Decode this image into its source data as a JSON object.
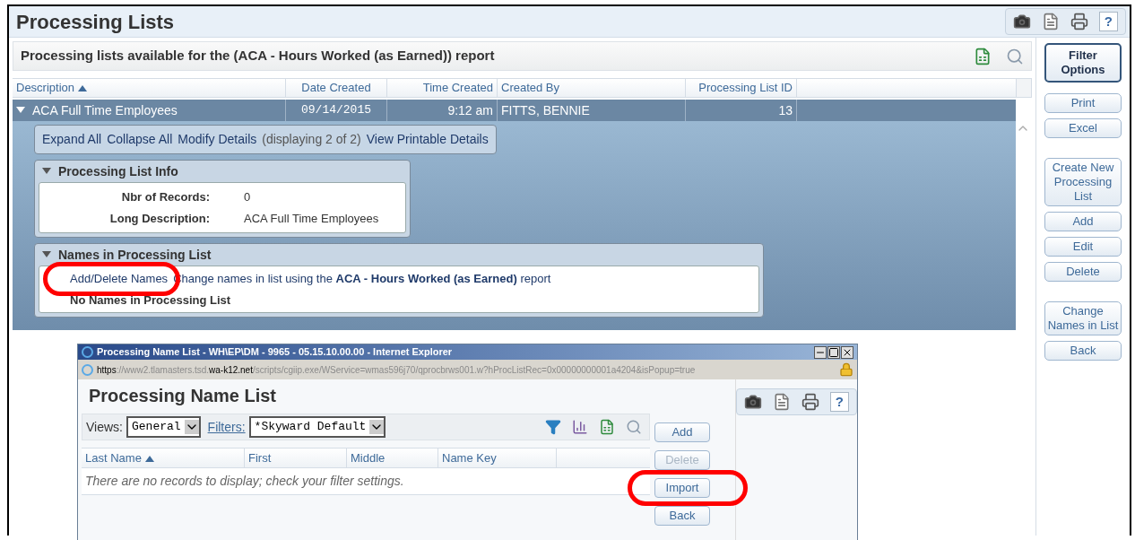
{
  "page": {
    "title": "Processing Lists",
    "help_glyph": "?",
    "subtitle": "Processing lists available for the (ACA - Hours Worked (as Earned)) report"
  },
  "table": {
    "columns": [
      {
        "label": "Description",
        "sorted": true
      },
      {
        "label": "Date Created",
        "sorted": false
      },
      {
        "label": "Time Created",
        "sorted": false
      },
      {
        "label": "Created By",
        "sorted": false
      },
      {
        "label": "Processing List ID",
        "sorted": false
      }
    ],
    "rows": [
      {
        "selected": true,
        "expanded": true,
        "cells": [
          "ACA Full Time Employees",
          "09/14/2015",
          "9:12 am",
          "FITTS, BENNIE",
          "13"
        ]
      }
    ]
  },
  "detail": {
    "links": [
      {
        "kind": "link",
        "text": "Expand All"
      },
      {
        "kind": "link",
        "text": "Collapse All"
      },
      {
        "kind": "link",
        "text": "Modify Details"
      },
      {
        "kind": "note",
        "text": "(displaying 2 of 2)"
      },
      {
        "kind": "link",
        "text": "View Printable Details"
      }
    ],
    "sections": [
      {
        "kind": "fields",
        "title": "Processing List Info",
        "expanded": true,
        "fields": [
          {
            "label": "Nbr of Records:",
            "value": "0"
          },
          {
            "label": "Long Description:",
            "value": "ACA Full Time Employees"
          }
        ]
      },
      {
        "kind": "names",
        "title": "Names in Processing List",
        "expanded": true,
        "link": {
          "text": "Add/Delete Names",
          "highlighted": true
        },
        "note": "Change names in list using the **ACA - Hours Worked (as Earned)** report",
        "empty": "No Names in Processing List"
      }
    ]
  },
  "sidebar": {
    "groups": [
      [
        {
          "kind": "primary",
          "label": "Filter Options"
        }
      ],
      [
        {
          "kind": "normal",
          "label": "Print"
        },
        {
          "kind": "normal",
          "label": "Excel"
        }
      ],
      [
        {
          "kind": "normal",
          "label": "Create New Processing List"
        },
        {
          "kind": "normal",
          "label": "Add"
        },
        {
          "kind": "normal",
          "label": "Edit"
        },
        {
          "kind": "normal",
          "label": "Delete"
        }
      ],
      [
        {
          "kind": "normal",
          "label": "Change Names in List"
        },
        {
          "kind": "normal",
          "label": "Back"
        }
      ]
    ]
  },
  "popup": {
    "window_title": "Processing Name List - WH\\EP\\DM - 9965 - 05.15.10.00.00 - Internet Explorer",
    "url": [
      {
        "text": "https",
        "strong": true
      },
      {
        "text": "://www2.tlamasters.tsd.",
        "strong": false
      },
      {
        "text": "wa-k12.net",
        "strong": true
      },
      {
        "text": "/scripts/cgiip.exe/WService=wmas596j70/qprocbrws001.w?hProcListRec=0x00000000001a4204&isPopup=true",
        "strong": false
      }
    ],
    "heading": "Processing Name List",
    "help_glyph": "?",
    "views_label": "Views:",
    "views_value": "General",
    "filters_label": "Filters:",
    "filters_value": "*Skyward Default",
    "columns": [
      {
        "label": "Last Name",
        "sorted": true
      },
      {
        "label": "First",
        "sorted": false
      },
      {
        "label": "Middle",
        "sorted": false
      },
      {
        "label": "Name Key",
        "sorted": false
      }
    ],
    "empty": "There are no records to display; check your filter settings.",
    "buttons": [
      {
        "disabled": false,
        "highlighted": false,
        "label": "Add"
      },
      {
        "disabled": true,
        "highlighted": false,
        "label": "Delete"
      },
      {
        "disabled": false,
        "highlighted": true,
        "label": "Import"
      },
      {
        "disabled": false,
        "highlighted": false,
        "label": "Back"
      }
    ]
  }
}
